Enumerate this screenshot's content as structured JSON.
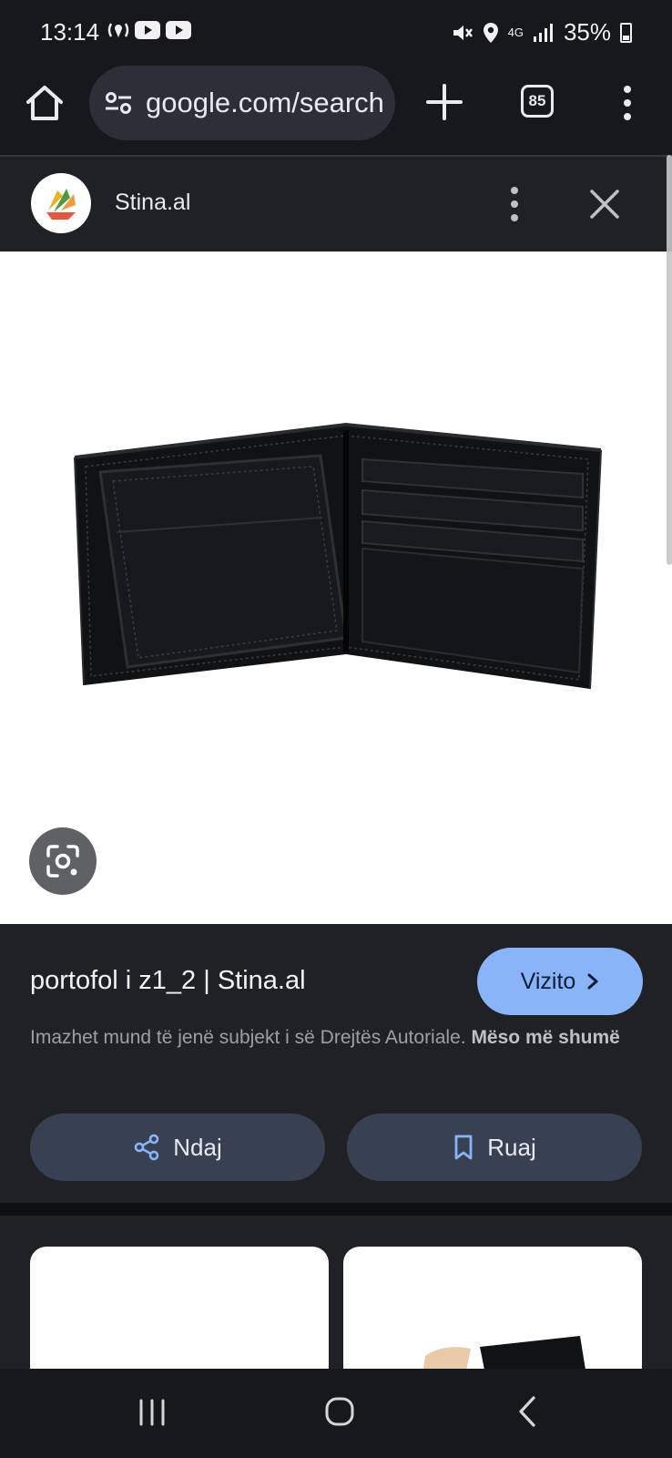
{
  "status_bar": {
    "time": "13:14",
    "network": "4G",
    "battery": "35%"
  },
  "browser": {
    "url": "google.com/search",
    "tab_count": "85"
  },
  "site_bar": {
    "site_name": "Stina.al"
  },
  "info": {
    "title": "portofol i z1_2 | Stina.al",
    "visit_label": "Vizito",
    "copyright_note": "Imazhet mund të jenë subjekt i së Drejtës Autoriale.",
    "learn_more": "Mëso më shumë",
    "share_label": "Ndaj",
    "save_label": "Ruaj"
  },
  "colors": {
    "accent": "#8ab4f8",
    "panel": "#202124",
    "button": "#374152"
  }
}
